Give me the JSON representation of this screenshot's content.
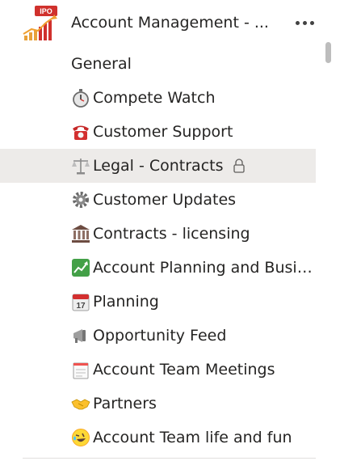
{
  "team": {
    "name": "Account Management - ...",
    "logo_badge": "IPO",
    "more_label": "More options"
  },
  "channels": [
    {
      "label": "General",
      "icon": "none"
    },
    {
      "label": "Compete Watch",
      "icon": "stopwatch-icon"
    },
    {
      "label": "Customer Support",
      "icon": "telephone-icon"
    },
    {
      "label": "Legal - Contracts",
      "icon": "scales-icon",
      "active": true,
      "locked": true
    },
    {
      "label": "Customer Updates",
      "icon": "gear-icon"
    },
    {
      "label": "Contracts - licensing",
      "icon": "classical-building-icon"
    },
    {
      "label": "Account Planning and Busin...",
      "icon": "chart-increasing-icon"
    },
    {
      "label": "Planning",
      "icon": "calendar-icon"
    },
    {
      "label": "Opportunity Feed",
      "icon": "megaphone-icon"
    },
    {
      "label": "Account Team Meetings",
      "icon": "spiral-notepad-icon"
    },
    {
      "label": "Partners",
      "icon": "handshake-icon"
    },
    {
      "label": "Account Team life and fun",
      "icon": "rolling-laughing-icon"
    }
  ],
  "calendar_day": "17",
  "colors": {
    "active_row": "#edebe9",
    "text": "#252423"
  }
}
